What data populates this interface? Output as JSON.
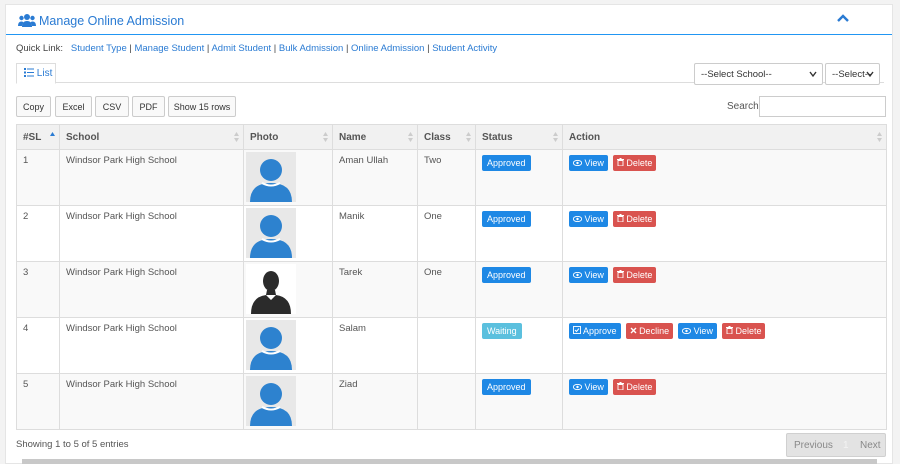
{
  "header": {
    "title": "Manage Online Admission",
    "icon": "users-icon",
    "collapse_icon": "chevron-up-icon"
  },
  "quick_links": {
    "label": "Quick Link:",
    "items": [
      "Student Type",
      "Manage Student",
      "Admit Student",
      "Bulk Admission",
      "Online Admission",
      "Student Activity"
    ],
    "separator": "|"
  },
  "tabs": {
    "list_label": "List"
  },
  "filters": {
    "school_placeholder": "--Select School--",
    "select_placeholder": "--Select--"
  },
  "export_buttons": [
    "Copy",
    "Excel",
    "CSV",
    "PDF",
    "Show 15 rows"
  ],
  "search": {
    "label": "Search:",
    "value": ""
  },
  "table": {
    "columns": [
      "#SL",
      "School",
      "Photo",
      "Name",
      "Class",
      "Status",
      "Action"
    ],
    "rows": [
      {
        "sl": "1",
        "school": "Windsor Park High School",
        "photo": "default-avatar",
        "name": "Aman Ullah",
        "class": "Two",
        "status": "Approved",
        "actions": [
          "View",
          "Delete"
        ]
      },
      {
        "sl": "2",
        "school": "Windsor Park High School",
        "photo": "default-avatar",
        "name": "Manik",
        "class": "One",
        "status": "Approved",
        "actions": [
          "View",
          "Delete"
        ]
      },
      {
        "sl": "3",
        "school": "Windsor Park High School",
        "photo": "silhouette-photo",
        "name": "Tarek",
        "class": "One",
        "status": "Approved",
        "actions": [
          "View",
          "Delete"
        ]
      },
      {
        "sl": "4",
        "school": "Windsor Park High School",
        "photo": "default-avatar",
        "name": "Salam",
        "class": "",
        "status": "Waiting",
        "actions": [
          "Approve",
          "Decline",
          "View",
          "Delete"
        ]
      },
      {
        "sl": "5",
        "school": "Windsor Park High School",
        "photo": "default-avatar",
        "name": "Ziad",
        "class": "",
        "status": "Approved",
        "actions": [
          "View",
          "Delete"
        ]
      }
    ]
  },
  "footer": {
    "info": "Showing 1 to 5 of 5 entries",
    "previous": "Previous",
    "current_page": "1",
    "next": "Next"
  },
  "colors": {
    "primary": "#1e88e5",
    "danger": "#d9534f",
    "info": "#5bc0de",
    "link": "#2a7bd3"
  }
}
